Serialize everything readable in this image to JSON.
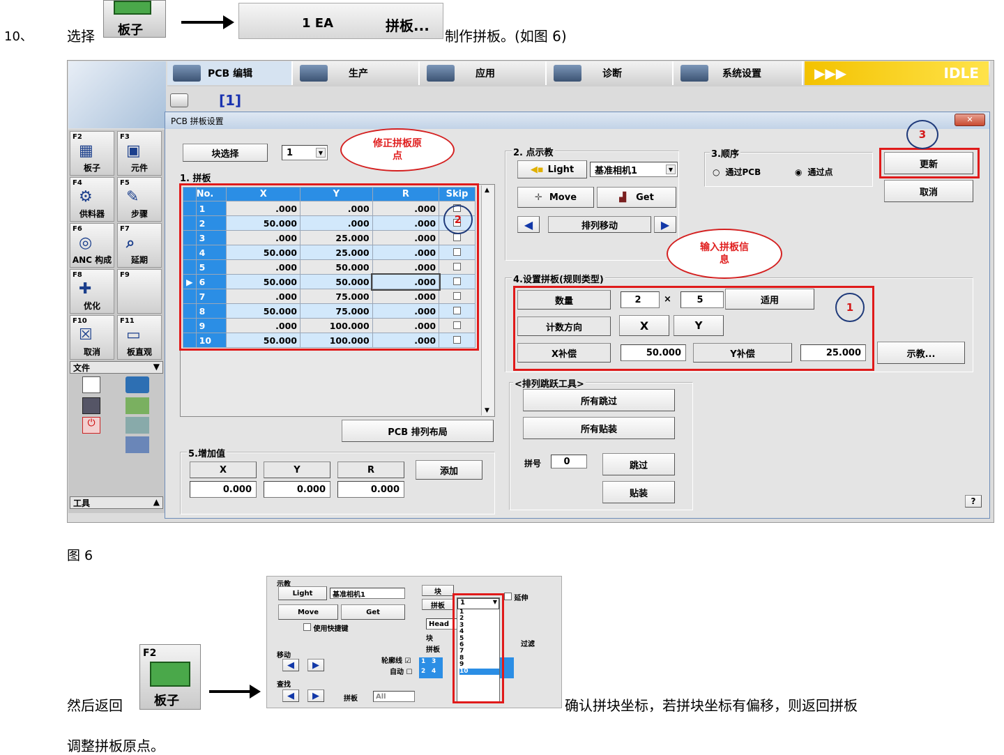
{
  "step": {
    "num": "10、",
    "pre": "选择",
    "btn_label": "板子",
    "ea_label": "1 EA",
    "pinban_label": "拼板...",
    "post": "制作拼板。(如图 6)"
  },
  "tabs": [
    "PCB 编辑",
    "生产",
    "应用",
    "诊断",
    "系统设置"
  ],
  "idle": "IDLE",
  "doc_tag": "[1]",
  "dialog": {
    "title": "PCB 拼板设置",
    "block_select": "块选择",
    "block_value": "1",
    "sec1": "1. 拼板",
    "grid_headers": [
      "No.",
      "X",
      "Y",
      "R",
      "Skip"
    ],
    "rows": [
      [
        "1",
        ".000",
        ".000",
        ".000"
      ],
      [
        "2",
        "50.000",
        ".000",
        ".000"
      ],
      [
        "3",
        ".000",
        "25.000",
        ".000"
      ],
      [
        "4",
        "50.000",
        "25.000",
        ".000"
      ],
      [
        "5",
        ".000",
        "50.000",
        ".000"
      ],
      [
        "6",
        "50.000",
        "50.000",
        ".000"
      ],
      [
        "7",
        ".000",
        "75.000",
        ".000"
      ],
      [
        "8",
        "50.000",
        "75.000",
        ".000"
      ],
      [
        "9",
        ".000",
        "100.000",
        ".000"
      ],
      [
        "10",
        "50.000",
        "100.000",
        ".000"
      ]
    ],
    "layout_btn": "PCB 排列布局",
    "sec5": "5.增加值",
    "inc_headers": [
      "X",
      "Y",
      "R"
    ],
    "inc_values": [
      "0.000",
      "0.000",
      "0.000"
    ],
    "add_btn": "添加",
    "sec2": "2. 点示教",
    "light": "Light",
    "camera": "基准相机1",
    "move": "Move",
    "get": "Get",
    "array_move": "排列移动",
    "sec3": "3.顺序",
    "opt1": "通过PCB",
    "opt2": "通过点",
    "update": "更新",
    "cancel": "取消",
    "sec4": "4.设置拼板(规则类型)",
    "qty_label": "数量",
    "qty_x": "2",
    "times": "×",
    "qty_y": "5",
    "apply": "适用",
    "dir_label": "计数方向",
    "dir_x": "X",
    "dir_y": "Y",
    "xstep_label": "X补偿",
    "xstep": "50.000",
    "ystep_label": "Y补偿",
    "ystep": "25.000",
    "teach": "示教...",
    "skip_tool": "<排列跳跃工具>",
    "all_skip": "所有跳过",
    "all_mount": "所有贴装",
    "pin_no": "拼号",
    "pin_value": "0",
    "skip": "跳过",
    "mount": "贴装",
    "help": "?"
  },
  "bubbles": {
    "b1": "修正拼板原点",
    "b2": "输入拼板信息",
    "c1": "1",
    "c2": "2",
    "c3": "3"
  },
  "left_panel": {
    "fkeys": [
      {
        "k": "F2",
        "n": "板子"
      },
      {
        "k": "F3",
        "n": "元件"
      },
      {
        "k": "F4",
        "n": "供料器"
      },
      {
        "k": "F5",
        "n": "步骤"
      },
      {
        "k": "F6",
        "n": "ANC 构成"
      },
      {
        "k": "F7",
        "n": "延期"
      },
      {
        "k": "F8",
        "n": "优化"
      },
      {
        "k": "F9",
        "n": ""
      },
      {
        "k": "F10",
        "n": "取消"
      },
      {
        "k": "F11",
        "n": "板直观"
      }
    ],
    "file": "文件",
    "tools": "工具"
  },
  "caption": "图 6",
  "small": {
    "teach": "示教",
    "light": "Light",
    "camera": "基准相机1",
    "move": "Move",
    "get": "Get",
    "shortcut": "使用快捷键",
    "move_sec": "移动",
    "contour": "轮廓线",
    "auto": "自动",
    "find": "查找",
    "pin": "拼板",
    "all": "All",
    "blk": "块",
    "pin2": "拼板",
    "extend": "延伸",
    "head": "Head",
    "blk2": "块",
    "pin3": "拼板",
    "filter": "过滤",
    "list": [
      "1",
      "2",
      "3",
      "4",
      "5",
      "6",
      "7",
      "8",
      "9",
      "10"
    ],
    "sel": "1",
    "cells": [
      "1",
      "3",
      "2",
      "4"
    ]
  },
  "bottom": {
    "pre": "然后返回",
    "btn": "板子",
    "key": "F2",
    "post": "确认拼块坐标，若拼块坐标有偏移，则返回拼板",
    "line2": "调整拼板原点。"
  }
}
